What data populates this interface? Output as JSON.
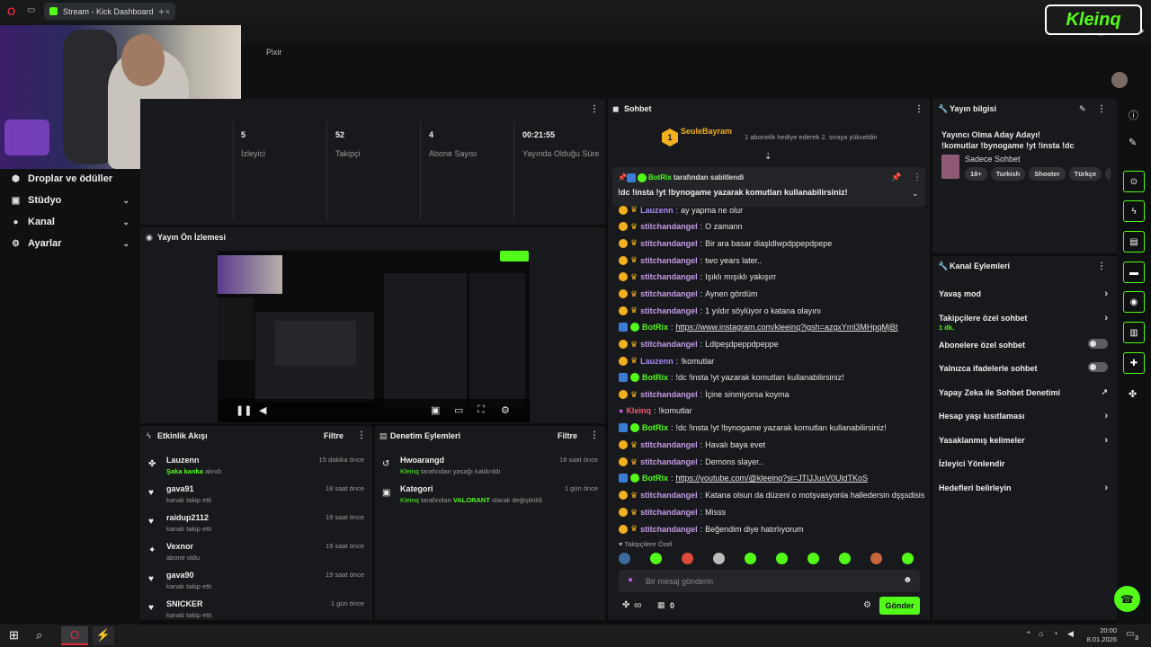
{
  "browser": {
    "tab_title": "Stream - Kick Dashboard",
    "pixir": "Pixir",
    "new_tab": "+"
  },
  "brand": {
    "logo_text": "Kleinq",
    "accent": "#53fc18"
  },
  "sidebar": {
    "items": [
      {
        "label": "Droplar ve ödüller",
        "icon": "gift-icon"
      },
      {
        "label": "Stüdyo",
        "icon": "chat-bubble-icon",
        "chev": "⌄"
      },
      {
        "label": "Kanal",
        "icon": "person-icon",
        "chev": "⌄"
      },
      {
        "label": "Ayarlar",
        "icon": "gear-icon",
        "chev": "⌄"
      }
    ]
  },
  "stats": {
    "items": [
      {
        "value": "5",
        "label": "İzleyici"
      },
      {
        "value": "52",
        "label": "Takipçi"
      },
      {
        "value": "4",
        "label": "Abone Sayısı"
      },
      {
        "value": "00:21:55",
        "label": "Yayında Olduğu Süre"
      }
    ]
  },
  "preview": {
    "title": "Yayın Ön İzlemesi"
  },
  "activity": {
    "title": "Etkinlik Akışı",
    "filter": "Filtre",
    "items": [
      {
        "name": "Lauzenn",
        "sub_hl": "Şaka kanka",
        "sub": " alındı",
        "time": "15 dakika önce",
        "icon": "sparkle-icon"
      },
      {
        "name": "gava91",
        "sub": "kanalı takip etti",
        "time": "18 saat önce",
        "icon": "heart-icon"
      },
      {
        "name": "raidup2112",
        "sub": "kanalı takip etti",
        "time": "19 saat önce",
        "icon": "heart-icon"
      },
      {
        "name": "Vexnor",
        "sub": "abone oldu",
        "time": "19 saat önce",
        "icon": "star-icon"
      },
      {
        "name": "gava90",
        "sub": "kanalı takip etti",
        "time": "19 saat önce",
        "icon": "heart-icon"
      },
      {
        "name": "SNICKER",
        "sub": "kanalı takip etti",
        "time": "1 gün önce",
        "icon": "heart-icon"
      }
    ]
  },
  "moderation": {
    "title": "Denetim Eylemleri",
    "filter": "Filtre",
    "items": [
      {
        "title": "Hwoarangd",
        "actor": "Kleinq",
        "text": " tarafından yasağı kaldırıldı",
        "time": "18 saat önce"
      },
      {
        "title": "Kategori",
        "actor": "Kleinq",
        "text": " tarafından ",
        "hl": "VALORANT",
        "text2": " olarak değiştirildi",
        "time": "1 gün önce"
      }
    ]
  },
  "chat": {
    "title": "Sohbet",
    "gifter": "SeuleBayram",
    "gifter_level": "1",
    "gift_text": "1 abonelik hediye ederek 2. sıraya yükseldin",
    "pinned_by": "BotRix",
    "pinned_by_suffix": " tarafından sabitlendi",
    "pinned_msg": "!dc !insta !yt !bynogame yazarak komutları kullanabilirsiniz!",
    "messages": [
      {
        "user": "Lauzenn",
        "text": "ay yapma ne olur",
        "cls": "u-blue",
        "badges": "sub"
      },
      {
        "user": "stitchandangel",
        "text": "O zamann",
        "cls": "u-pink",
        "badges": "subcrown"
      },
      {
        "user": "stitchandangel",
        "text": "Bir ara basar diaşldlwpdppepdpepe",
        "cls": "u-pink",
        "badges": "subcrown"
      },
      {
        "user": "stitchandangel",
        "text": "two years later..",
        "cls": "u-pink",
        "badges": "subcrown"
      },
      {
        "user": "stitchandangel",
        "text": "Işıklı mışıklı yakışırr",
        "cls": "u-pink",
        "badges": "subcrown"
      },
      {
        "user": "stitchandangel",
        "text": "Aynen gördüm",
        "cls": "u-pink",
        "badges": "subcrown"
      },
      {
        "user": "stitchandangel",
        "text": "1 yıldır söylüyor o katana olayını",
        "cls": "u-pink",
        "badges": "subcrown"
      },
      {
        "user": "BotRix",
        "text": "https://www.instagram.com/kleeinq?igsh=azgxYml3MHpqMjBt",
        "cls": "u-green",
        "badges": "bot",
        "link": true
      },
      {
        "user": "stitchandangel",
        "text": "Ldlpeşdpeppdpeppe",
        "cls": "u-pink",
        "badges": "subcrown"
      },
      {
        "user": "Lauzenn",
        "text": "!komutlar",
        "cls": "u-blue",
        "badges": "sub"
      },
      {
        "user": "BotRix",
        "text": "!dc !insta !yt yazarak komutları kullanabilirsiniz!",
        "cls": "u-green",
        "badges": "bot"
      },
      {
        "user": "stitchandangel",
        "text": "İçine sinmiyorsa koyma",
        "cls": "u-pink",
        "badges": "subcrown"
      },
      {
        "user": "Kleinq",
        "text": "!komutlar",
        "cls": "u-red",
        "badges": "mic"
      },
      {
        "user": "BotRix",
        "text": "!dc !insta !yt !bynogame yazarak komutları kullanabilirsiniz!",
        "cls": "u-green",
        "badges": "bot"
      },
      {
        "user": "stitchandangel",
        "text": "Havalı baya evet",
        "cls": "u-pink",
        "badges": "subcrown"
      },
      {
        "user": "stitchandangel",
        "text": "Demons slayer..",
        "cls": "u-pink",
        "badges": "subcrown"
      },
      {
        "user": "BotRix",
        "text": "https://youtube.com/@kleeinq?si=JTIJJusV0UldTKoS",
        "cls": "u-green",
        "badges": "bot",
        "link": true
      },
      {
        "user": "stitchandangel",
        "text": "Katana olsun da düzeni o motşvasyonla halledersin dşşsdisis",
        "cls": "u-pink",
        "badges": "subcrown"
      },
      {
        "user": "stitchandangel",
        "text": "Misss",
        "cls": "u-pink",
        "badges": "subcrown"
      },
      {
        "user": "stitchandangel",
        "text": "Beğendim diye hatırlıyorum",
        "cls": "u-pink",
        "badges": "subcrown"
      }
    ],
    "followers_only_label": "Takipçilere Özel",
    "input_placeholder": "Bir mesaj gönderin",
    "points": "0",
    "send": "Gönder",
    "infinity": "∞"
  },
  "stream_info": {
    "title": "Yayın bilgisi",
    "stream_title": "Yayıncı Olma Aday Adayı! !komutlar !bynogame !yt !insta !dc",
    "category": "Sadece Sohbet",
    "tags": [
      "18+",
      "Turkish",
      "Shooter",
      "Türkçe",
      "fp"
    ]
  },
  "channel_actions": {
    "title": "Kanal Eylemleri",
    "items": [
      {
        "label": "Yavaş mod",
        "kind": "chev"
      },
      {
        "label": "Takipçilere özel sohbet",
        "sub": "1 dk.",
        "kind": "chev"
      },
      {
        "label": "Abonelere özel sohbet",
        "kind": "toggle"
      },
      {
        "label": "Yalnızca ifadelerle sohbet",
        "kind": "toggle"
      },
      {
        "label": "Yapay Zeka ile Sohbet Denetimi",
        "kind": "ext"
      },
      {
        "label": "Hesap yaşı kısıtlaması",
        "kind": "chev"
      },
      {
        "label": "Yasaklanmış kelimeler",
        "kind": "chev"
      },
      {
        "label": "İzleyici Yönlendir",
        "kind": "none"
      },
      {
        "label": "Hedefleri belirleyin",
        "kind": "chev"
      }
    ]
  },
  "taskbar": {
    "time": "20:00",
    "date": "8.01.2026",
    "notif": "3"
  }
}
